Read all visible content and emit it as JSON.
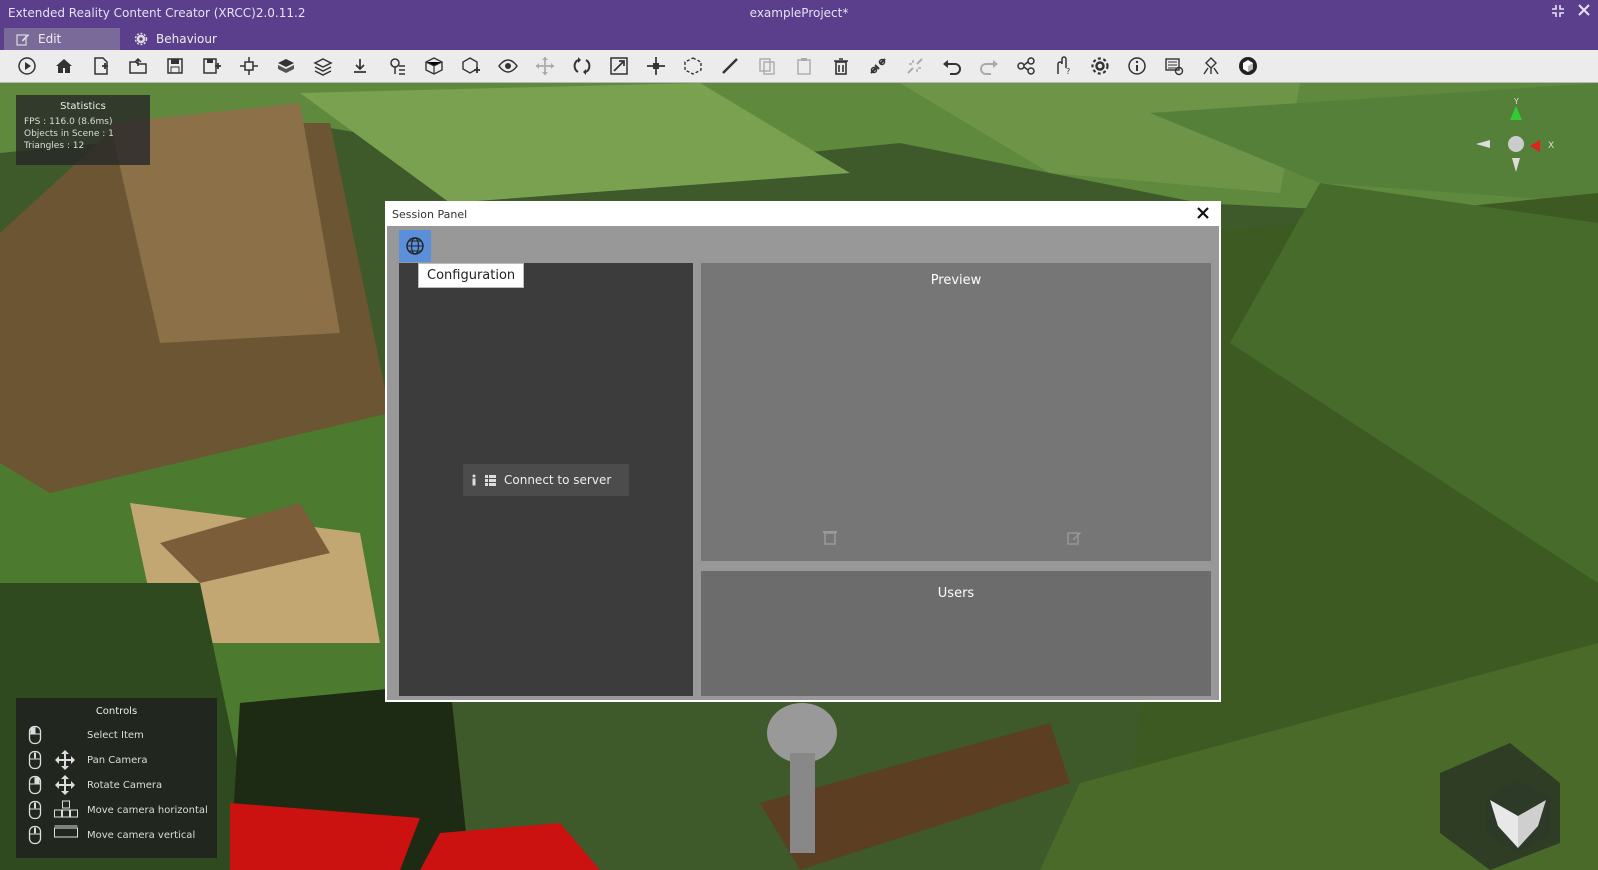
{
  "window": {
    "app_title": "Extended Reality Content Creator (XRCC)2.0.11.2",
    "project_title": "exampleProject*"
  },
  "tabs": [
    {
      "label": "Edit",
      "icon": "edit-icon",
      "active": true
    },
    {
      "label": "Behaviour",
      "icon": "gear-icon",
      "active": false
    }
  ],
  "toolbar": {
    "buttons": [
      {
        "name": "play-icon"
      },
      {
        "name": "home-icon"
      },
      {
        "name": "new-project-icon"
      },
      {
        "name": "open-project-icon"
      },
      {
        "name": "save-icon"
      },
      {
        "name": "save-as-icon"
      },
      {
        "name": "import-icon"
      },
      {
        "name": "assets-icon"
      },
      {
        "name": "layers-icon"
      },
      {
        "name": "export-icon"
      },
      {
        "name": "locator-icon"
      },
      {
        "name": "cube-outline-icon"
      },
      {
        "name": "cube-add-icon"
      },
      {
        "name": "eye-icon"
      },
      {
        "name": "move-icon",
        "disabled": true
      },
      {
        "name": "rotate-icon"
      },
      {
        "name": "scale-icon"
      },
      {
        "name": "transform-icon"
      },
      {
        "name": "box-select-icon"
      },
      {
        "name": "ruler-icon"
      },
      {
        "name": "copy-icon",
        "disabled": true
      },
      {
        "name": "paste-icon",
        "disabled": true
      },
      {
        "name": "delete-icon"
      },
      {
        "name": "link-icon"
      },
      {
        "name": "unlink-icon",
        "disabled": true
      },
      {
        "name": "undo-icon"
      },
      {
        "name": "redo-icon",
        "disabled": true
      },
      {
        "name": "share-icon"
      },
      {
        "name": "hand-help-icon"
      },
      {
        "name": "settings-icon"
      },
      {
        "name": "info-icon"
      },
      {
        "name": "library-icon"
      },
      {
        "name": "network-icon"
      },
      {
        "name": "unity-icon"
      }
    ]
  },
  "statistics": {
    "title": "Statistics",
    "lines": [
      "FPS : 116.0 (8.6ms)",
      "Objects in Scene : 1",
      "Triangles : 12"
    ]
  },
  "controls": {
    "title": "Controls",
    "items": [
      {
        "label": "Select Item",
        "mouse": "left",
        "move_icon": ""
      },
      {
        "label": "Pan Camera",
        "mouse": "middle",
        "move_icon": "move-arrows-icon"
      },
      {
        "label": "Rotate Camera",
        "mouse": "right",
        "move_icon": "move-arrows-icon"
      },
      {
        "label": "Move camera horizontal",
        "mouse": "middle",
        "move_icon": "wasd-keys-icon"
      },
      {
        "label": "Move camera vertical",
        "mouse": "middle",
        "move_icon": "spacebar-icon"
      }
    ]
  },
  "gizmo": {
    "y_label": "Y",
    "x_label": "X"
  },
  "session_panel": {
    "title": "Session Panel",
    "config_tooltip": "Configuration",
    "connect_label": "Connect to server",
    "preview_title": "Preview",
    "users_title": "Users"
  },
  "colors": {
    "titlebar": "#5b3e8c",
    "accent": "#5b8fd9"
  }
}
